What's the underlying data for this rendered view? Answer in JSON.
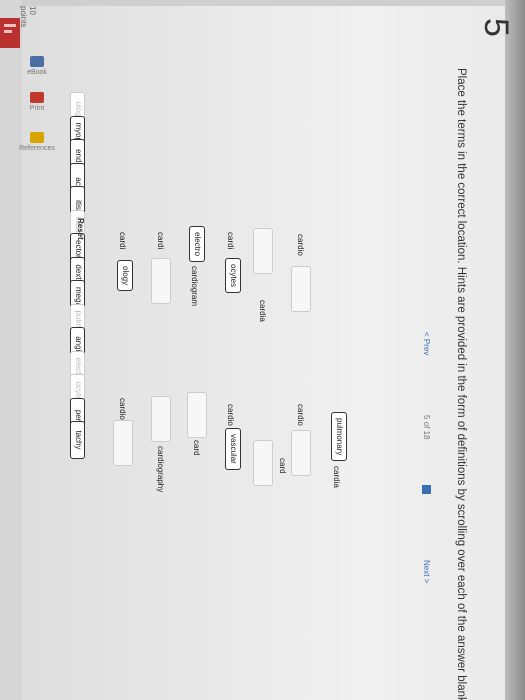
{
  "question_number": "5",
  "points": {
    "value": "10",
    "unit": "points"
  },
  "instructions": "Place the terms in the correct location. Hints are provided in the form of definitions by scrolling over each of the answer blanks.",
  "nav": [
    {
      "label": "eBook"
    },
    {
      "label": "Print"
    },
    {
      "label": "References"
    }
  ],
  "word_bank": [
    {
      "text": "ology",
      "used": true
    },
    {
      "text": "myopathy",
      "used": false
    },
    {
      "text": "endo",
      "used": false
    },
    {
      "text": "ac",
      "used": false
    },
    {
      "text": "itis",
      "used": false
    },
    {
      "text": "vascular",
      "used": true
    },
    {
      "text": "ectomy",
      "used": false
    },
    {
      "text": "dextro",
      "used": false
    },
    {
      "text": "megaly",
      "used": false
    },
    {
      "text": "pulmonary",
      "used": true
    },
    {
      "text": "angio",
      "used": false
    },
    {
      "text": "electro",
      "used": true
    },
    {
      "text": "ocytes",
      "used": true
    },
    {
      "text": "peri",
      "used": false
    },
    {
      "text": "tachy",
      "used": false
    }
  ],
  "reset_label": "Reset",
  "answers": {
    "row1": {
      "a_label": "cardi",
      "a_fill": "ology",
      "b_label": "cardio"
    },
    "row2": {
      "a_label": "cardi",
      "b_label": "cardiography"
    },
    "row3": {
      "a_fill": "electro",
      "a_label": "cardiogram",
      "b_label": "card"
    },
    "row4": {
      "a_label": "cardi",
      "a_fill": "ocytes",
      "b_label": "cardio",
      "b_fill": "vascular"
    },
    "row5": {
      "a_label": "cardia",
      "b_label": "card"
    },
    "row6": {
      "a_label": "cardio",
      "b_label": "cardio"
    },
    "row7": {
      "b_fill": "pulmonary",
      "b_label": "cardia"
    }
  },
  "pagination": {
    "prev": "Prev",
    "current": "5",
    "of": "of",
    "total": "18",
    "next": "Next"
  }
}
